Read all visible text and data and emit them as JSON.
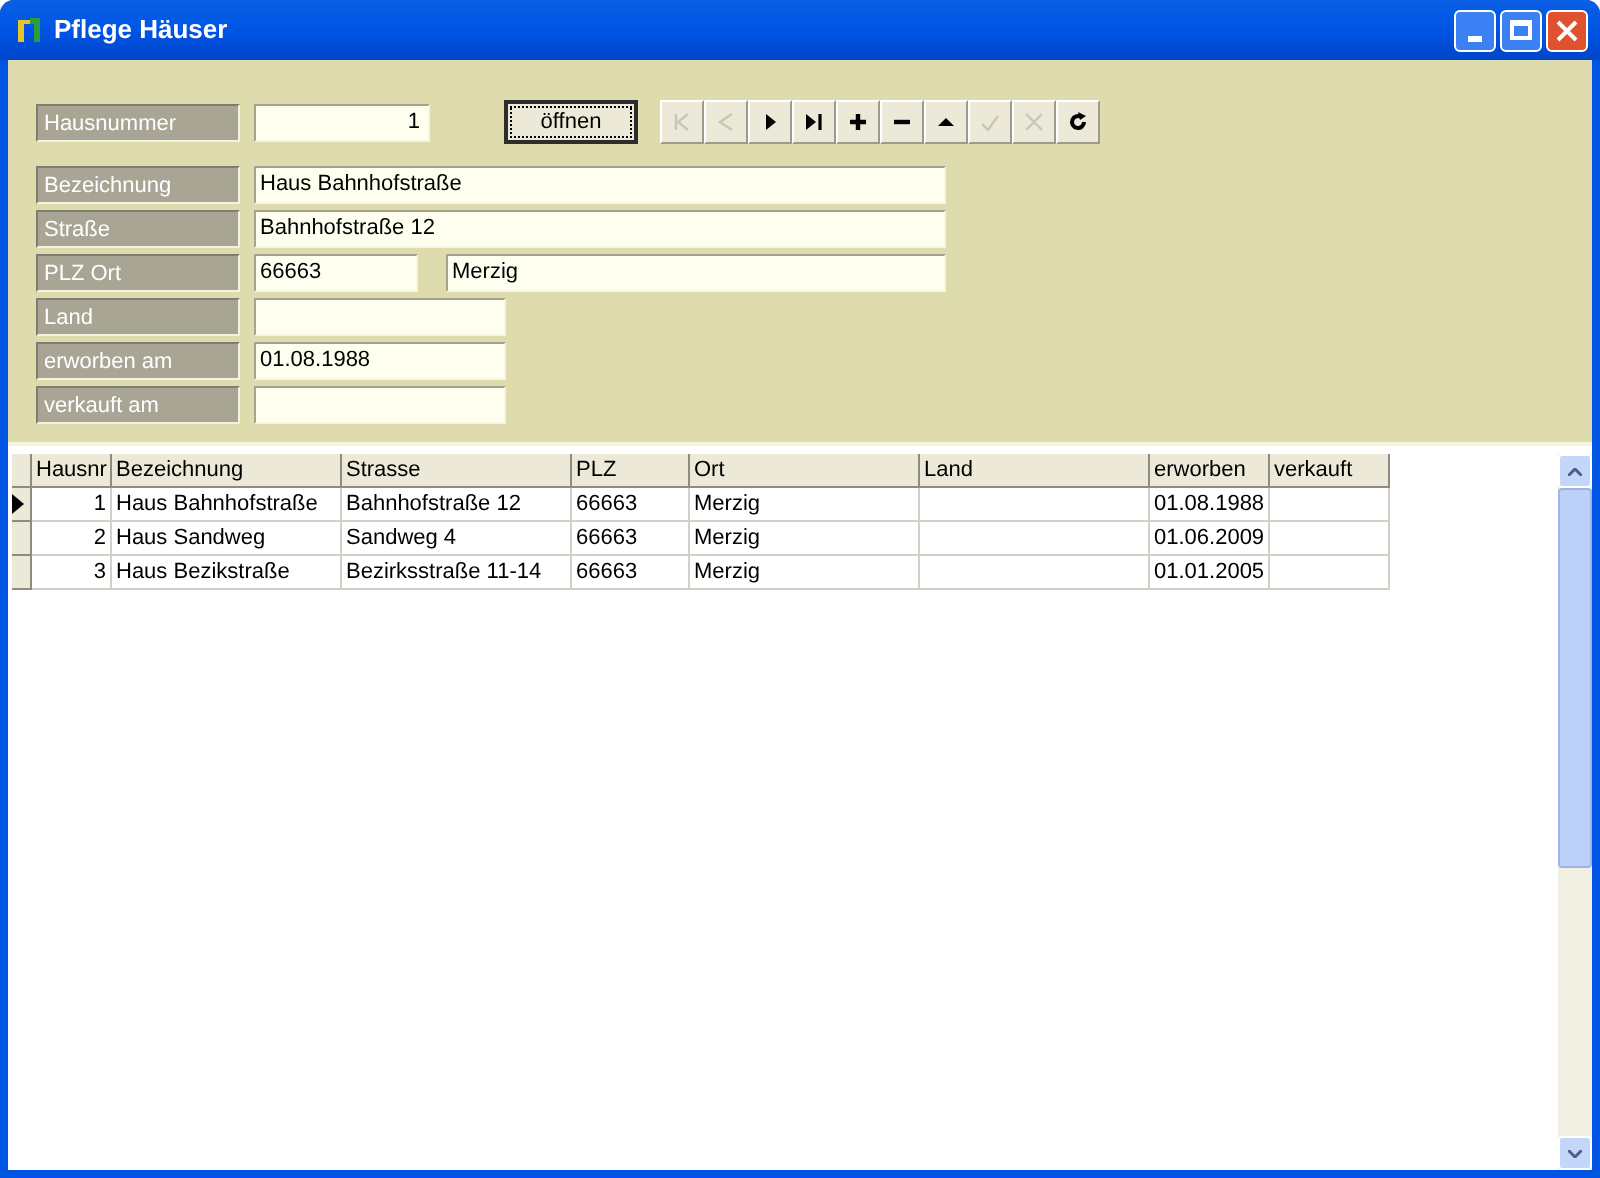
{
  "window": {
    "title": "Pflege Häuser"
  },
  "form": {
    "house_number": {
      "label": "Hausnummer",
      "value": "1"
    },
    "open_button": "öffnen",
    "navigator": [
      {
        "kind": "first",
        "disabled": true
      },
      {
        "kind": "prior",
        "disabled": true
      },
      {
        "kind": "next",
        "disabled": false
      },
      {
        "kind": "last",
        "disabled": false
      },
      {
        "kind": "insert",
        "disabled": false
      },
      {
        "kind": "delete",
        "disabled": false
      },
      {
        "kind": "edit",
        "disabled": false
      },
      {
        "kind": "post",
        "disabled": true
      },
      {
        "kind": "cancel",
        "disabled": true
      },
      {
        "kind": "refresh",
        "disabled": false
      }
    ],
    "fields": [
      {
        "label": "Bezeichnung",
        "values": [
          "Haus Bahnhofstraße"
        ],
        "kind": "wide"
      },
      {
        "label": "Straße",
        "values": [
          "Bahnhofstraße 12"
        ],
        "kind": "wide"
      },
      {
        "label": "PLZ Ort",
        "values": [
          "66663",
          "Merzig"
        ],
        "kind": "split"
      },
      {
        "label": "Land",
        "kind": "short"
      },
      {
        "label": "erworben am",
        "values": [
          "01.08.1988"
        ],
        "kind": "short"
      },
      {
        "label": "verkauft am",
        "kind": "short"
      }
    ]
  },
  "table": {
    "columns": [
      "Hausnr",
      "Bezeichnung",
      "Strasse",
      "PLZ",
      "Ort",
      "Land",
      "erworben",
      "verkauft"
    ],
    "rows": [
      {
        "selected": true,
        "cells": [
          "1",
          "Haus Bahnhofstraße",
          "Bahnhofstraße 12",
          "66663",
          "Merzig",
          "",
          "01.08.1988",
          ""
        ]
      },
      {
        "selected": false,
        "cells": [
          "2",
          "Haus Sandweg",
          "Sandweg 4",
          "66663",
          "Merzig",
          "",
          "01.06.2009",
          ""
        ]
      },
      {
        "selected": false,
        "cells": [
          "3",
          "Haus Bezikstraße",
          "Bezirksstraße  11-14",
          "66663",
          "Merzig",
          "",
          "01.01.2005",
          ""
        ]
      }
    ]
  }
}
